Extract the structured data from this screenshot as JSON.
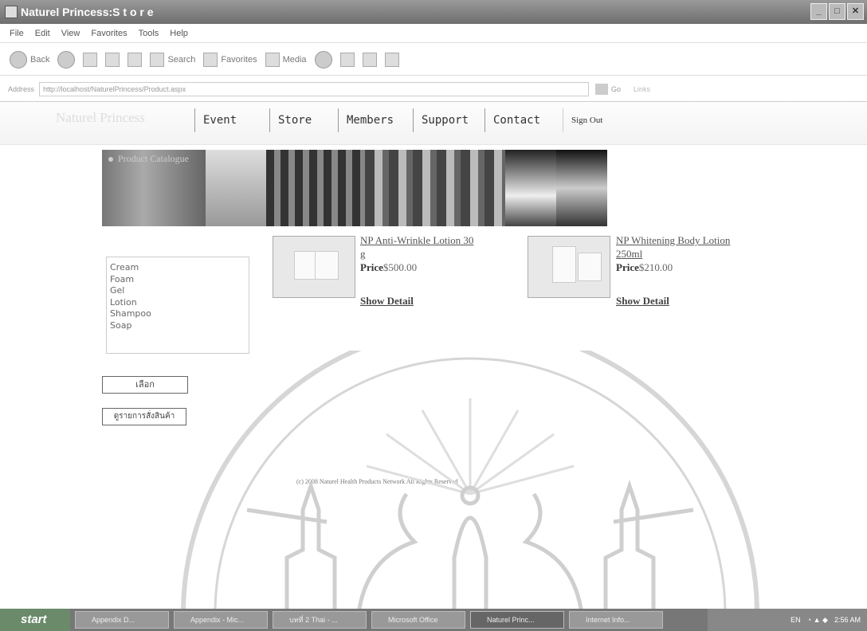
{
  "window": {
    "title": "Naturel Princess:S t o r e",
    "controls": [
      "_",
      "□",
      "✕"
    ]
  },
  "menubar": [
    "File",
    "Edit",
    "View",
    "Favorites",
    "Tools",
    "Help"
  ],
  "toolbar": {
    "back": "Back",
    "search": "Search",
    "favorites": "Favorites",
    "media": "Media"
  },
  "address": {
    "label": "Address",
    "url": "http://localhost/NaturelPrincess/Product.aspx",
    "go": "Go",
    "links": "Links"
  },
  "sitenav": {
    "brand": "Naturel Princess",
    "tabs": [
      "Event",
      "Store",
      "Members",
      "Support",
      "Contact"
    ],
    "signout": "Sign Out"
  },
  "banner": {
    "caption": "Product Catalogue"
  },
  "categories": [
    "Cream",
    "Foam",
    "Gel",
    "Lotion",
    "Shampoo",
    "Soap"
  ],
  "buttons": {
    "select": "เลือก",
    "view_order": "ดูรายการสั่งสินค้า"
  },
  "products": [
    {
      "name_line1": "NP Anti-Wrinkle Lotion 30",
      "name_line2": "g",
      "price_label": "Price",
      "price": "$500.00",
      "detail": "Show Detail"
    },
    {
      "name_line1": "NP Whitening Body Lotion",
      "name_line2": "250ml",
      "price_label": "Price",
      "price": "$210.00",
      "detail": "Show Detail"
    }
  ],
  "footer": {
    "copyright": "(c) 2008 Naturel Health Products Network All Rights Reserved"
  },
  "taskbar": {
    "start": "start",
    "tasks": [
      "Appendix D...",
      "Appendix - Mic...",
      "บทที่ 2 Thai - ...",
      "Microsoft Office",
      "Naturel Princ...",
      "Internet Info..."
    ],
    "lang": "EN",
    "clock": "2:56 AM"
  },
  "colors": {
    "titlebar": "#7a7a7a",
    "taskbar": "#777777",
    "start_button": "#6a8a6a"
  }
}
